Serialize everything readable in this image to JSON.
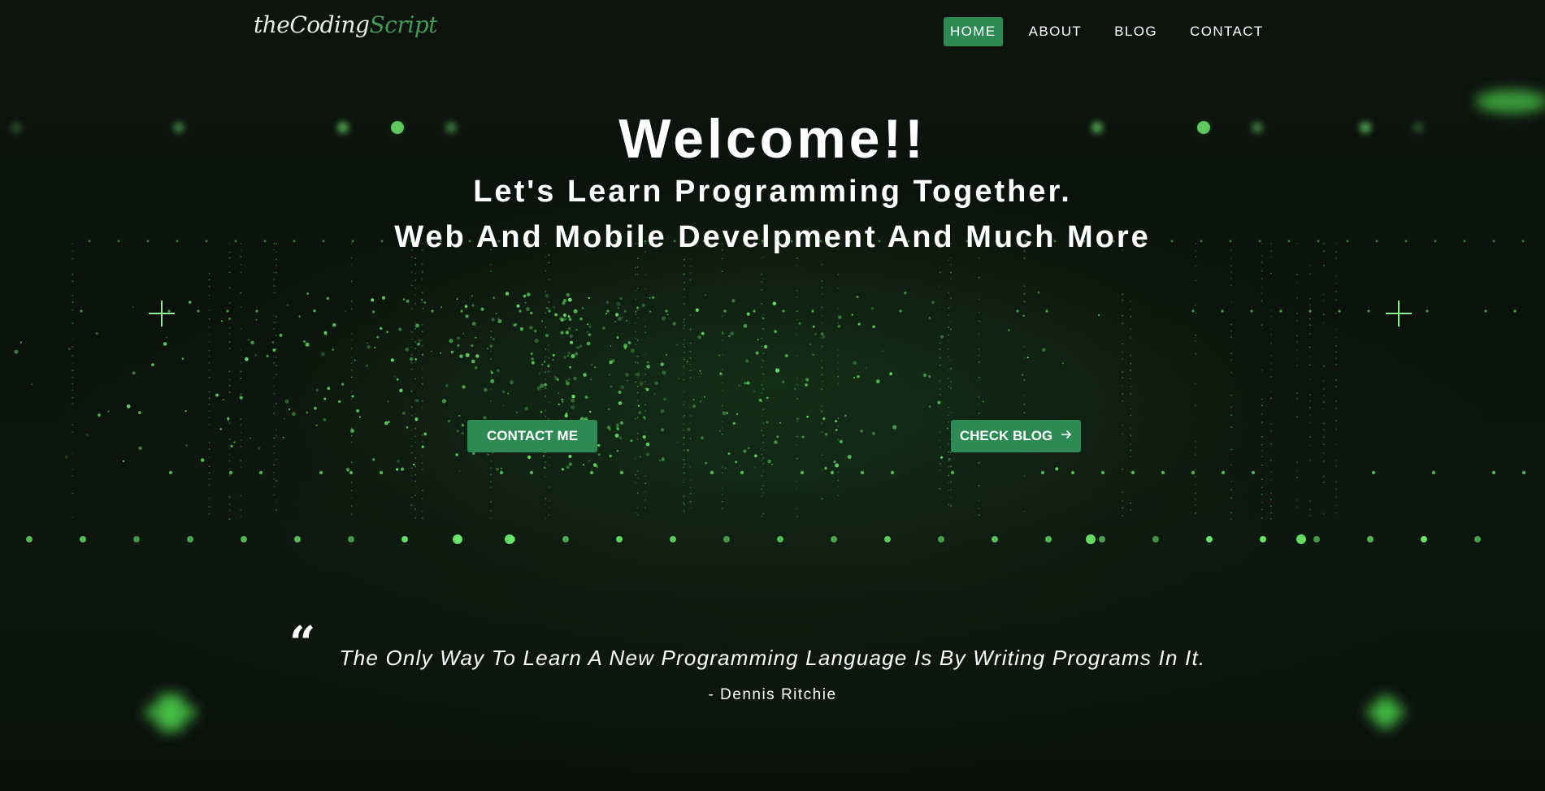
{
  "brand": {
    "logo_part1": "theCoding",
    "logo_part2": "Script"
  },
  "nav": {
    "items": [
      {
        "label": "HOME",
        "active": true
      },
      {
        "label": "ABOUT",
        "active": false
      },
      {
        "label": "BLOG",
        "active": false
      },
      {
        "label": "CONTACT",
        "active": false
      }
    ]
  },
  "hero": {
    "title": "Welcome!!",
    "subtitle_1": "Let's Learn Programming Together.",
    "subtitle_2": "Web And Mobile Develpment And Much More",
    "contact_button": "CONTACT ME",
    "blog_button": "CHECK BLOG",
    "blog_button_icon": "arrow-right-icon"
  },
  "quote": {
    "text": "The Only Way To Learn A New Programming Language Is By Writing Programs In It.",
    "author": "- Dennis Ritchie",
    "icon": "quote-icon"
  },
  "colors": {
    "accent": "#2e8a55",
    "background": "#0c110d",
    "glow": "#5fe05f"
  }
}
